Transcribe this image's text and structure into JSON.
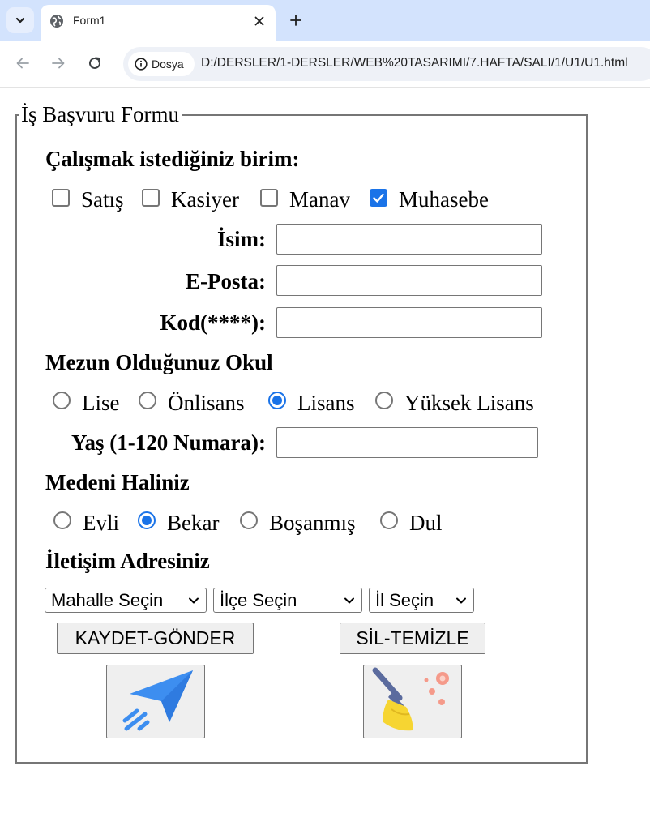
{
  "browser": {
    "tab_title": "Form1",
    "site_chip": "Dosya",
    "url": "D:/DERSLER/1-DERSLER/WEB%20TASARIMI/7.HAFTA/SALI/1/U1/U1.html"
  },
  "form": {
    "legend": "İş Başvuru Formu",
    "unit_heading": "Çalışmak istediğiniz birim:",
    "units": [
      {
        "label": "Satış",
        "checked": false
      },
      {
        "label": "Kasiyer",
        "checked": false
      },
      {
        "label": "Manav",
        "checked": false
      },
      {
        "label": "Muhasebe",
        "checked": true
      }
    ],
    "name_label": "İsim:",
    "name_value": "",
    "email_label": "E-Posta:",
    "email_value": "",
    "code_label": "Kod(****):",
    "code_value": "",
    "school_heading": "Mezun Olduğunuz Okul",
    "schools": [
      {
        "label": "Lise",
        "checked": false
      },
      {
        "label": "Önlisans",
        "checked": false
      },
      {
        "label": "Lisans",
        "checked": true
      },
      {
        "label": "Yüksek Lisans",
        "checked": false
      }
    ],
    "age_label": "Yaş (1-120 Numara):",
    "age_value": "",
    "marital_heading": "Medeni Haliniz",
    "marital": [
      {
        "label": "Evli",
        "checked": false
      },
      {
        "label": "Bekar",
        "checked": true
      },
      {
        "label": "Boşanmış",
        "checked": false
      },
      {
        "label": "Dul",
        "checked": false
      }
    ],
    "address_heading": "İletişim Adresiniz",
    "selects": {
      "neighborhood": "Mahalle Seçin",
      "district": "İlçe Seçin",
      "city": "İl Seçin"
    },
    "save_button": "KAYDET-GÖNDER",
    "clear_button": "SİL-TEMİZLE"
  },
  "colors": {
    "accent": "#1a73e8",
    "tabstrip": "#d3e3fd",
    "plane": "#3d8ef0",
    "broom_head": "#f6d532",
    "broom_handle": "#5b6b9e",
    "dots": "#f59a8a"
  }
}
